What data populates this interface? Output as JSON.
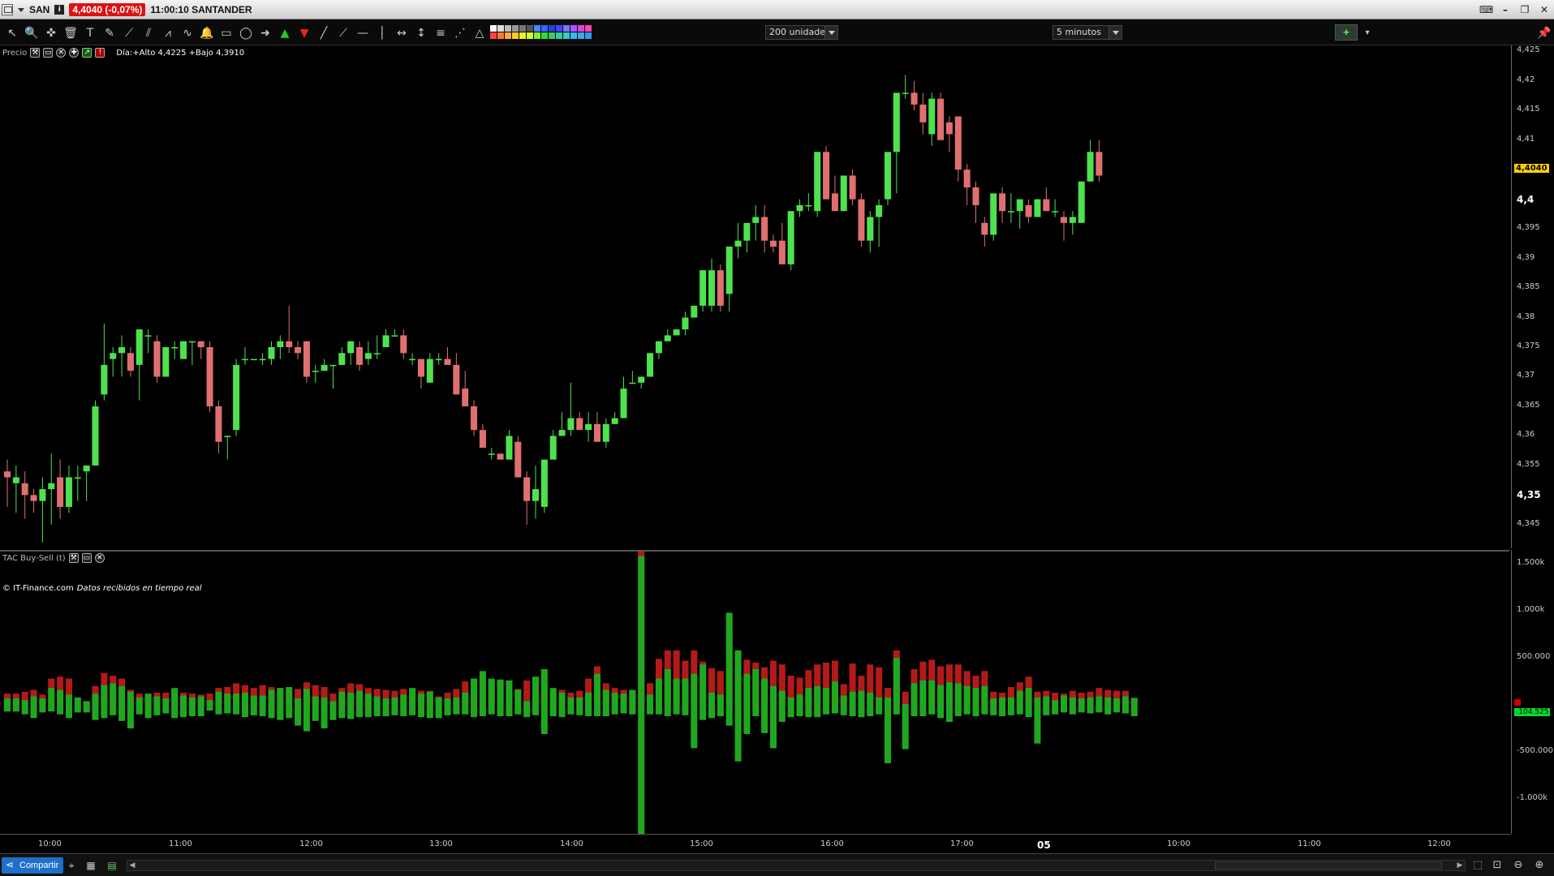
{
  "window": {
    "ticker": "SAN",
    "info_badge": "i",
    "price_badge": "4,4040 (-0,07%)",
    "title": "11:00:10 SANTANDER"
  },
  "toolbar": {
    "units_value": "200 unidades",
    "interval_value": "5 minutos",
    "add_indicator_label": "+"
  },
  "price_panel": {
    "name": "Precio",
    "day_range": "Día:+Alto 4,4225 +Bajo 4,3910",
    "copyright": "© IT-Finance.com",
    "realtime_note": "Datos recibidos en tiempo real",
    "last_price": "4,4040"
  },
  "osc_panel": {
    "name": "TAC Buy-Sell (t)",
    "last_value": "-104.525"
  },
  "statusbar": {
    "share_label": "Compartir"
  },
  "colors": {
    "up": "#4ee24e",
    "down": "#e07070",
    "vol_buy": "#1fa81f",
    "vol_sell": "#b51a1a",
    "accent": "#ffd000"
  },
  "chart_data": [
    {
      "type": "candlestick",
      "title": "",
      "ylim": [
        4.341,
        4.426
      ],
      "y_ticks": [
        "4,345",
        "4,35",
        "4,355",
        "4,36",
        "4,365",
        "4,37",
        "4,375",
        "4,38",
        "4,385",
        "4,39",
        "4,395",
        "4,4",
        "4,405",
        "4,41",
        "4,415",
        "4,42",
        "4,425"
      ],
      "y_ticks_bold": [
        "4,35",
        "4,4"
      ],
      "x_ticks": [
        "10:00",
        "11:00",
        "12:00",
        "13:00",
        "14:00",
        "15:00",
        "16:00",
        "17:00",
        "05",
        "10:00",
        "11:00",
        "12:00"
      ],
      "x_ticks_bold": [
        "05"
      ],
      "candles": [
        [
          4.354,
          4.356,
          4.348,
          4.353
        ],
        [
          4.352,
          4.355,
          4.347,
          4.353
        ],
        [
          4.352,
          4.354,
          4.346,
          4.35
        ],
        [
          4.35,
          4.351,
          4.347,
          4.349
        ],
        [
          4.349,
          4.353,
          4.342,
          4.351
        ],
        [
          4.351,
          4.357,
          4.345,
          4.352
        ],
        [
          4.353,
          4.356,
          4.346,
          4.348
        ],
        [
          4.348,
          4.355,
          4.347,
          4.353
        ],
        [
          4.353,
          4.355,
          4.349,
          4.353
        ],
        [
          4.354,
          4.355,
          4.349,
          4.355
        ],
        [
          4.355,
          4.366,
          4.355,
          4.365
        ],
        [
          4.367,
          4.379,
          4.366,
          4.372
        ],
        [
          4.373,
          4.375,
          4.37,
          4.374
        ],
        [
          4.374,
          4.377,
          4.37,
          4.375
        ],
        [
          4.374,
          4.375,
          4.37,
          4.371
        ],
        [
          4.372,
          4.378,
          4.366,
          4.378
        ],
        [
          4.377,
          4.378,
          4.374,
          4.377
        ],
        [
          4.376,
          4.377,
          4.369,
          4.37
        ],
        [
          4.37,
          4.375,
          4.37,
          4.375
        ],
        [
          4.375,
          4.376,
          4.373,
          4.375
        ],
        [
          4.373,
          4.376,
          4.373,
          4.376
        ],
        [
          4.376,
          4.376,
          4.372,
          4.376
        ],
        [
          4.376,
          4.376,
          4.373,
          4.375
        ],
        [
          4.375,
          4.376,
          4.364,
          4.365
        ],
        [
          4.365,
          4.366,
          4.357,
          4.359
        ],
        [
          4.36,
          4.36,
          4.356,
          4.36
        ],
        [
          4.361,
          4.373,
          4.36,
          4.372
        ],
        [
          4.373,
          4.375,
          4.372,
          4.373
        ],
        [
          4.373,
          4.373,
          4.373,
          4.373
        ],
        [
          4.373,
          4.374,
          4.372,
          4.373
        ],
        [
          4.373,
          4.376,
          4.372,
          4.375
        ],
        [
          4.375,
          4.377,
          4.373,
          4.376
        ],
        [
          4.376,
          4.382,
          4.374,
          4.375
        ],
        [
          4.375,
          4.376,
          4.373,
          4.374
        ],
        [
          4.376,
          4.376,
          4.369,
          4.37
        ],
        [
          4.371,
          4.372,
          4.369,
          4.371
        ],
        [
          4.371,
          4.373,
          4.371,
          4.372
        ],
        [
          4.372,
          4.372,
          4.368,
          4.372
        ],
        [
          4.372,
          4.375,
          4.372,
          4.374
        ],
        [
          4.374,
          4.376,
          4.372,
          4.376
        ],
        [
          4.375,
          4.376,
          4.371,
          4.372
        ],
        [
          4.373,
          4.376,
          4.372,
          4.374
        ],
        [
          4.374,
          4.377,
          4.373,
          4.374
        ],
        [
          4.375,
          4.378,
          4.375,
          4.377
        ],
        [
          4.377,
          4.378,
          4.377,
          4.377
        ],
        [
          4.377,
          4.378,
          4.373,
          4.374
        ],
        [
          4.373,
          4.374,
          4.372,
          4.373
        ],
        [
          4.373,
          4.373,
          4.368,
          4.37
        ],
        [
          4.369,
          4.374,
          4.369,
          4.373
        ],
        [
          4.373,
          4.374,
          4.372,
          4.373
        ],
        [
          4.373,
          4.375,
          4.372,
          4.372
        ],
        [
          4.372,
          4.374,
          4.368,
          4.367
        ],
        [
          4.368,
          4.371,
          4.366,
          4.365
        ],
        [
          4.365,
          4.366,
          4.36,
          4.361
        ],
        [
          4.361,
          4.362,
          4.358,
          4.358
        ],
        [
          4.357,
          4.358,
          4.356,
          4.357
        ],
        [
          4.357,
          4.357,
          4.356,
          4.356
        ],
        [
          4.356,
          4.361,
          4.356,
          4.36
        ],
        [
          4.359,
          4.36,
          4.353,
          4.353
        ],
        [
          4.353,
          4.354,
          4.345,
          4.349
        ],
        [
          4.349,
          4.355,
          4.346,
          4.351
        ],
        [
          4.348,
          4.355,
          4.347,
          4.356
        ],
        [
          4.356,
          4.361,
          4.356,
          4.36
        ],
        [
          4.36,
          4.364,
          4.36,
          4.361
        ],
        [
          4.361,
          4.369,
          4.36,
          4.363
        ],
        [
          4.363,
          4.364,
          4.362,
          4.361
        ],
        [
          4.361,
          4.364,
          4.359,
          4.362
        ],
        [
          4.362,
          4.364,
          4.36,
          4.359
        ],
        [
          4.359,
          4.363,
          4.358,
          4.362
        ],
        [
          4.362,
          4.364,
          4.362,
          4.363
        ],
        [
          4.363,
          4.37,
          4.363,
          4.368
        ],
        [
          4.369,
          4.371,
          4.369,
          4.369
        ],
        [
          4.369,
          4.37,
          4.368,
          4.37
        ],
        [
          4.37,
          4.374,
          4.37,
          4.374
        ],
        [
          4.374,
          4.376,
          4.373,
          4.376
        ],
        [
          4.376,
          4.378,
          4.376,
          4.377
        ],
        [
          4.377,
          4.378,
          4.377,
          4.378
        ],
        [
          4.378,
          4.381,
          4.377,
          4.38
        ],
        [
          4.38,
          4.382,
          4.38,
          4.382
        ],
        [
          4.382,
          4.388,
          4.381,
          4.388
        ],
        [
          4.382,
          4.39,
          4.381,
          4.388
        ],
        [
          4.388,
          4.389,
          4.381,
          4.382
        ],
        [
          4.384,
          4.392,
          4.381,
          4.392
        ],
        [
          4.392,
          4.396,
          4.39,
          4.393
        ],
        [
          4.393,
          4.396,
          4.391,
          4.396
        ],
        [
          4.396,
          4.399,
          4.393,
          4.397
        ],
        [
          4.397,
          4.399,
          4.391,
          4.393
        ],
        [
          4.393,
          4.394,
          4.391,
          4.392
        ],
        [
          4.393,
          4.396,
          4.389,
          4.389
        ],
        [
          4.389,
          4.398,
          4.388,
          4.398
        ],
        [
          4.398,
          4.4,
          4.397,
          4.399
        ],
        [
          4.399,
          4.401,
          4.398,
          4.399
        ],
        [
          4.398,
          4.401,
          4.397,
          4.408
        ],
        [
          4.408,
          4.409,
          4.4,
          4.4
        ],
        [
          4.401,
          4.404,
          4.398,
          4.398
        ],
        [
          4.398,
          4.404,
          4.398,
          4.404
        ],
        [
          4.404,
          4.405,
          4.399,
          4.4
        ],
        [
          4.4,
          4.401,
          4.392,
          4.393
        ],
        [
          4.393,
          4.398,
          4.391,
          4.397
        ],
        [
          4.397,
          4.4,
          4.392,
          4.399
        ],
        [
          4.4,
          4.404,
          4.399,
          4.408
        ],
        [
          4.408,
          4.413,
          4.401,
          4.418
        ],
        [
          4.418,
          4.421,
          4.417,
          4.418
        ],
        [
          4.418,
          4.42,
          4.415,
          4.416
        ],
        [
          4.416,
          4.418,
          4.411,
          4.413
        ],
        [
          4.411,
          4.418,
          4.409,
          4.417
        ],
        [
          4.417,
          4.418,
          4.41,
          4.41
        ],
        [
          4.413,
          4.414,
          4.408,
          4.411
        ],
        [
          4.414,
          4.414,
          4.403,
          4.405
        ],
        [
          4.405,
          4.406,
          4.399,
          4.402
        ],
        [
          4.402,
          4.403,
          4.396,
          4.399
        ],
        [
          4.396,
          4.397,
          4.392,
          4.394
        ],
        [
          4.394,
          4.4,
          4.393,
          4.401
        ],
        [
          4.401,
          4.402,
          4.396,
          4.398
        ],
        [
          4.398,
          4.401,
          4.396,
          4.398
        ],
        [
          4.398,
          4.4,
          4.395,
          4.4
        ],
        [
          4.399,
          4.4,
          4.396,
          4.397
        ],
        [
          4.397,
          4.4,
          4.397,
          4.4
        ],
        [
          4.4,
          4.402,
          4.398,
          4.398
        ],
        [
          4.398,
          4.4,
          4.397,
          4.398
        ],
        [
          4.397,
          4.398,
          4.393,
          4.396
        ],
        [
          4.396,
          4.398,
          4.394,
          4.397
        ],
        [
          4.396,
          4.403,
          4.396,
          4.403
        ],
        [
          4.403,
          4.41,
          4.403,
          4.408
        ],
        [
          4.408,
          4.41,
          4.403,
          4.404
        ]
      ]
    },
    {
      "type": "bar",
      "title": "",
      "ylim": [
        -1350000,
        1650000
      ],
      "y_ticks": [
        "1.500k",
        "1.000k",
        "500.000",
        "-500.000",
        "-1.000k"
      ],
      "series": [
        {
          "values": [
            90,
            90,
            70,
            110,
            90,
            200,
            180,
            130,
            100,
            60,
            140,
            230,
            250,
            220,
            160,
            100,
            140,
            110,
            90,
            200,
            120,
            100,
            110,
            70,
            160,
            140,
            140,
            150,
            120,
            120,
            180,
            200,
            210,
            90,
            190,
            110,
            100,
            60,
            160,
            150,
            170,
            140,
            110,
            90,
            100,
            130,
            200,
            140,
            160,
            100,
            90,
            100,
            150,
            300,
            380,
            300,
            290,
            280,
            180,
            60,
            320,
            400,
            200,
            150,
            100,
            100,
            150,
            350,
            180,
            150,
            140,
            180,
            1600,
            130,
            300,
            400,
            300,
            300,
            350,
            450,
            150,
            130,
            1000,
            600,
            350,
            400,
            300,
            220,
            170,
            100,
            130,
            200,
            220,
            200,
            270,
            120,
            160,
            170,
            150,
            100,
            100,
            520,
            30,
            250,
            280,
            280,
            230,
            260,
            250,
            220,
            200,
            220,
            90,
            100,
            100,
            170,
            200,
            100,
            110,
            70,
            120,
            100,
            90,
            100,
            110,
            100,
            90,
            110,
            95
          ]
        },
        {
          "values": [
            140,
            140,
            160,
            180,
            130,
            300,
            320,
            300,
            80,
            60,
            220,
            360,
            330,
            300,
            180,
            140,
            120,
            150,
            150,
            180,
            150,
            140,
            130,
            140,
            200,
            210,
            250,
            230,
            200,
            230,
            210,
            200,
            200,
            190,
            260,
            230,
            210,
            140,
            200,
            250,
            240,
            200,
            190,
            180,
            170,
            190,
            190,
            170,
            170,
            110,
            150,
            190,
            270,
            280,
            300,
            280,
            280,
            230,
            190,
            280,
            310,
            250,
            180,
            180,
            150,
            170,
            300,
            430,
            250,
            200,
            180,
            180,
            1850,
            250,
            510,
            600,
            600,
            490,
            600,
            480,
            410,
            380,
            750,
            340,
            500,
            470,
            420,
            490,
            450,
            330,
            310,
            390,
            450,
            470,
            490,
            240,
            460,
            330,
            450,
            420,
            200,
            600,
            160,
            400,
            480,
            500,
            430,
            450,
            450,
            380,
            330,
            380,
            160,
            150,
            210,
            260,
            320,
            160,
            170,
            150,
            140,
            170,
            150,
            160,
            200,
            180,
            170,
            170,
            95
          ]
        },
        {
          "values": [
            -50,
            -50,
            -80,
            -120,
            -60,
            -50,
            -80,
            -120,
            -60,
            -60,
            -140,
            -120,
            -90,
            -150,
            -230,
            -80,
            -120,
            -90,
            -70,
            -120,
            -110,
            -100,
            -100,
            -40,
            -80,
            -70,
            -80,
            -110,
            -90,
            -100,
            -120,
            -140,
            -120,
            -200,
            -260,
            -150,
            -230,
            -140,
            -120,
            -130,
            -110,
            -110,
            -100,
            -100,
            -90,
            -100,
            -90,
            -110,
            -120,
            -120,
            -90,
            -80,
            -80,
            -110,
            -100,
            -80,
            -100,
            -100,
            -80,
            -110,
            -90,
            -290,
            -100,
            -110,
            -80,
            -90,
            -100,
            -100,
            -100,
            -80,
            -70,
            -80,
            -1350,
            -80,
            -80,
            -100,
            -80,
            -90,
            -440,
            -140,
            -120,
            -100,
            -200,
            -580,
            -290,
            -100,
            -280,
            -440,
            -160,
            -110,
            -100,
            -110,
            -110,
            -80,
            -70,
            -90,
            -100,
            -110,
            -100,
            -80,
            -600,
            -80,
            -450,
            -100,
            -100,
            -80,
            -120,
            -160,
            -100,
            -80,
            -100,
            -80,
            -90,
            -100,
            -90,
            -80,
            -110,
            -390,
            -90,
            -80,
            -60,
            -80,
            -60,
            -70,
            -60,
            -80,
            -60,
            -70,
            -100
          ]
        }
      ]
    }
  ]
}
